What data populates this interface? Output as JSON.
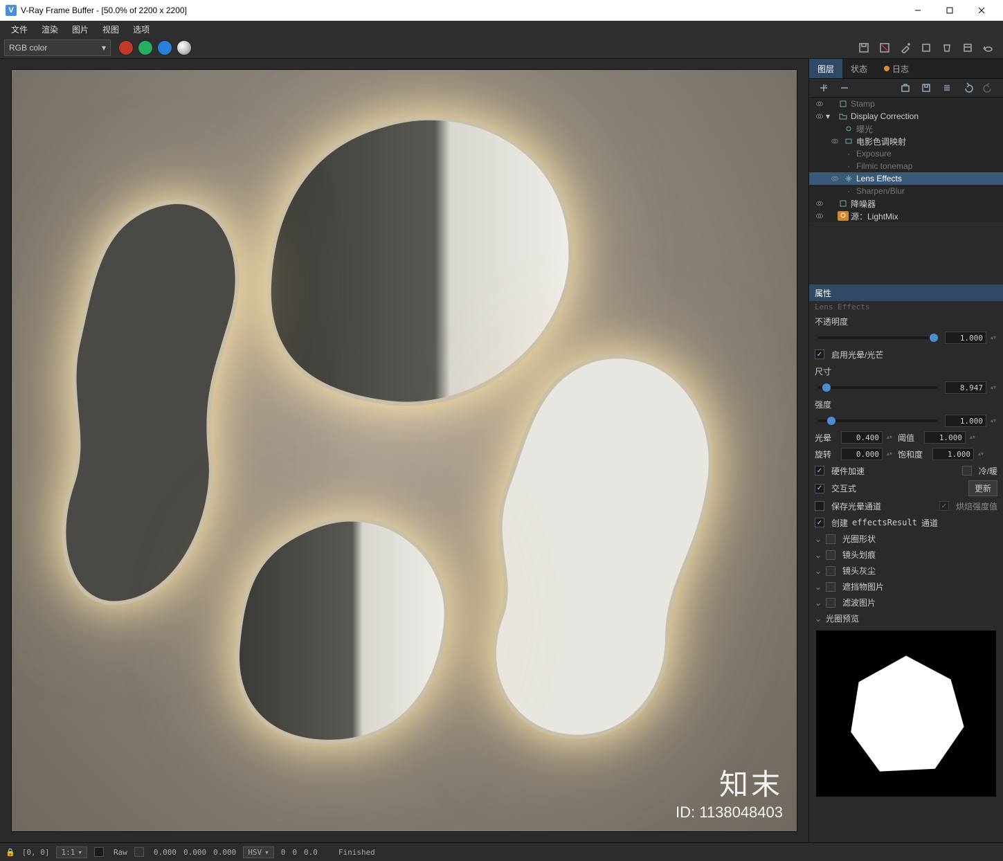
{
  "window": {
    "title": "V-Ray Frame Buffer - [50.0% of 2200 x 2200]"
  },
  "menu": {
    "file": "文件",
    "render": "渲染",
    "image": "图片",
    "view": "视图",
    "options": "选项"
  },
  "toolbar": {
    "channel": "RGB color"
  },
  "sidebar": {
    "tabs": {
      "layers": "图层",
      "status": "状态",
      "log": "日志"
    },
    "layers": {
      "stamp": "Stamp",
      "display_correction": "Display Correction",
      "exposure_cn": "曝光",
      "film_color": "电影色调映射",
      "exposure_en": "Exposure",
      "filmic": "Filmic tonemap",
      "lens_effects": "Lens Effects",
      "sharpen": "Sharpen/Blur",
      "denoiser": "降噪器",
      "lightmix": "源：LightMix"
    },
    "properties": {
      "header": "属性",
      "sub": "Lens Effects",
      "opacity_label": "不透明度",
      "opacity_value": "1.000",
      "enable_glare": "启用光晕/光芒",
      "size_label": "尺寸",
      "size_value": "8.947",
      "intensity_label": "强度",
      "intensity_value": "1.000",
      "glare_label": "光晕",
      "glare_value": "0.400",
      "threshold_label": "阈值",
      "threshold_value": "1.000",
      "rotation_label": "旋转",
      "rotation_value": "0.000",
      "saturation_label": "饱和度",
      "saturation_value": "1.000",
      "hw_accel": "硬件加速",
      "cold_warm": "冷/暖",
      "interactive": "交互式",
      "update_btn": "更新",
      "save_glare": "保存光晕通道",
      "bake_intensity": "烘焙强度值",
      "create_channel_prefix": "创建 ",
      "create_channel_mid": "effectsResult",
      "create_channel_suffix": " 通道",
      "iris_shape": "光圈形状",
      "lens_scratches": "镜头划痕",
      "lens_dust": "镜头灰尘",
      "obstacle_img": "遮挡物图片",
      "filter_img": "滤波图片",
      "iris_preview": "光圈预览"
    }
  },
  "statusbar": {
    "coords": "[0, 0]",
    "ratio": "1:1",
    "raw": "Raw",
    "zero1": "0.000",
    "zero2": "0.000",
    "zero3": "0.000",
    "hsv": "HSV",
    "h": "0",
    "s": "0",
    "v": "0.0",
    "finished": "Finished"
  },
  "watermark": {
    "brand": "知末",
    "id": "ID: 1138048403"
  }
}
